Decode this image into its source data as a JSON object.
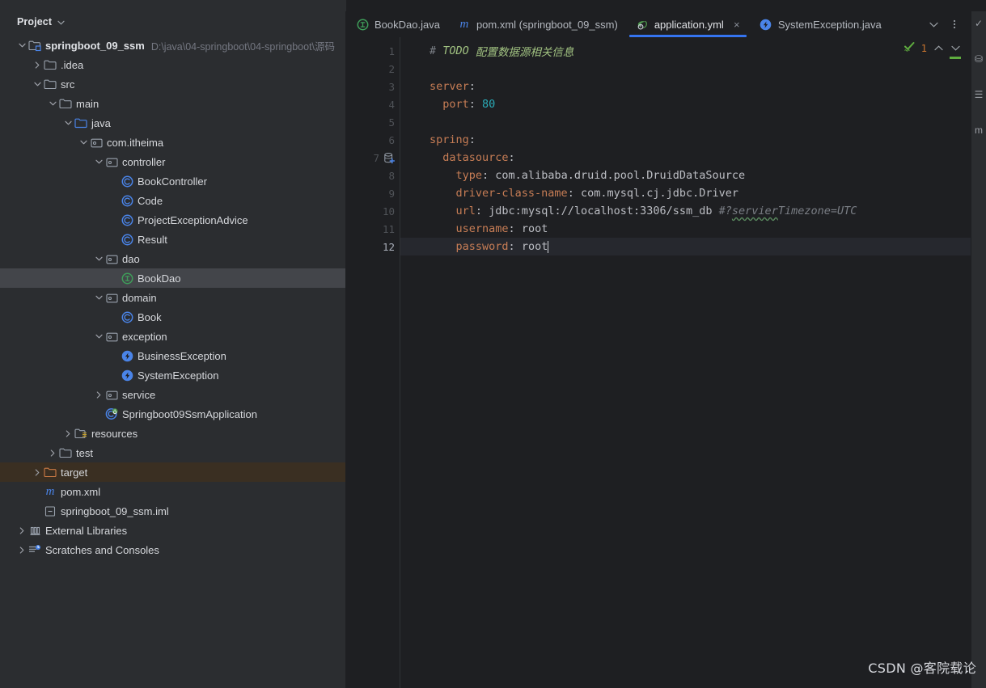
{
  "sidebar": {
    "panel_title": "Project",
    "panel_chevron": "chevron-down",
    "tree": [
      {
        "indent": 0,
        "arrow": "down",
        "icon": "module-folder-icon",
        "label": "springboot_09_ssm",
        "bold": true,
        "sub": "D:\\java\\04-springboot\\04-springboot\\源码",
        "state": "normal"
      },
      {
        "indent": 1,
        "arrow": "right",
        "icon": "folder-icon",
        "label": ".idea",
        "bold": false,
        "sub": "",
        "state": "normal"
      },
      {
        "indent": 1,
        "arrow": "down",
        "icon": "folder-icon",
        "label": "src",
        "bold": false,
        "sub": "",
        "state": "normal"
      },
      {
        "indent": 2,
        "arrow": "down",
        "icon": "folder-icon",
        "label": "main",
        "bold": false,
        "sub": "",
        "state": "normal"
      },
      {
        "indent": 3,
        "arrow": "down",
        "icon": "source-root-icon",
        "label": "java",
        "bold": false,
        "sub": "",
        "state": "normal"
      },
      {
        "indent": 4,
        "arrow": "down",
        "icon": "package-icon",
        "label": "com.itheima",
        "bold": false,
        "sub": "",
        "state": "normal"
      },
      {
        "indent": 5,
        "arrow": "down",
        "icon": "package-icon",
        "label": "controller",
        "bold": false,
        "sub": "",
        "state": "normal"
      },
      {
        "indent": 6,
        "arrow": "none",
        "icon": "class-icon",
        "label": "BookController",
        "bold": false,
        "sub": "",
        "state": "normal"
      },
      {
        "indent": 6,
        "arrow": "none",
        "icon": "class-icon",
        "label": "Code",
        "bold": false,
        "sub": "",
        "state": "normal"
      },
      {
        "indent": 6,
        "arrow": "none",
        "icon": "class-icon",
        "label": "ProjectExceptionAdvice",
        "bold": false,
        "sub": "",
        "state": "normal"
      },
      {
        "indent": 6,
        "arrow": "none",
        "icon": "class-icon",
        "label": "Result",
        "bold": false,
        "sub": "",
        "state": "normal"
      },
      {
        "indent": 5,
        "arrow": "down",
        "icon": "package-icon",
        "label": "dao",
        "bold": false,
        "sub": "",
        "state": "normal"
      },
      {
        "indent": 6,
        "arrow": "none",
        "icon": "interface-icon",
        "label": "BookDao",
        "bold": false,
        "sub": "",
        "state": "selected"
      },
      {
        "indent": 5,
        "arrow": "down",
        "icon": "package-icon",
        "label": "domain",
        "bold": false,
        "sub": "",
        "state": "normal"
      },
      {
        "indent": 6,
        "arrow": "none",
        "icon": "class-icon",
        "label": "Book",
        "bold": false,
        "sub": "",
        "state": "normal"
      },
      {
        "indent": 5,
        "arrow": "down",
        "icon": "package-icon",
        "label": "exception",
        "bold": false,
        "sub": "",
        "state": "normal"
      },
      {
        "indent": 6,
        "arrow": "none",
        "icon": "exception-class-icon",
        "label": "BusinessException",
        "bold": false,
        "sub": "",
        "state": "normal"
      },
      {
        "indent": 6,
        "arrow": "none",
        "icon": "exception-class-icon",
        "label": "SystemException",
        "bold": false,
        "sub": "",
        "state": "normal"
      },
      {
        "indent": 5,
        "arrow": "right",
        "icon": "package-icon",
        "label": "service",
        "bold": false,
        "sub": "",
        "state": "normal"
      },
      {
        "indent": 5,
        "arrow": "none",
        "icon": "spring-boot-class-icon",
        "label": "Springboot09SsmApplication",
        "bold": false,
        "sub": "",
        "state": "normal"
      },
      {
        "indent": 3,
        "arrow": "right",
        "icon": "resources-root-icon",
        "label": "resources",
        "bold": false,
        "sub": "",
        "state": "normal"
      },
      {
        "indent": 2,
        "arrow": "right",
        "icon": "folder-icon",
        "label": "test",
        "bold": false,
        "sub": "",
        "state": "normal"
      },
      {
        "indent": 1,
        "arrow": "right",
        "icon": "excluded-folder-icon",
        "label": "target",
        "bold": false,
        "sub": "",
        "state": "excluded"
      },
      {
        "indent": 1,
        "arrow": "none",
        "icon": "maven-icon",
        "label": "pom.xml",
        "bold": false,
        "sub": "",
        "state": "normal"
      },
      {
        "indent": 1,
        "arrow": "none",
        "icon": "iml-file-icon",
        "label": "springboot_09_ssm.iml",
        "bold": false,
        "sub": "",
        "state": "normal"
      },
      {
        "indent": 0,
        "arrow": "right",
        "icon": "external-libraries-icon",
        "label": "External Libraries",
        "bold": false,
        "sub": "",
        "state": "normal"
      },
      {
        "indent": 0,
        "arrow": "right",
        "icon": "scratches-icon",
        "label": "Scratches and Consoles",
        "bold": false,
        "sub": "",
        "state": "normal"
      }
    ]
  },
  "editor": {
    "tabs": [
      {
        "label": "BookDao.java",
        "icon": "interface-icon",
        "active": false,
        "closable": false
      },
      {
        "label": "pom.xml (springboot_09_ssm)",
        "icon": "maven-icon",
        "active": false,
        "closable": false
      },
      {
        "label": "application.yml",
        "icon": "spring-yaml-icon",
        "active": true,
        "closable": true
      },
      {
        "label": "SystemException.java",
        "icon": "exception-class-icon",
        "active": false,
        "closable": false
      }
    ],
    "tab_actions": [
      {
        "name": "tab-list-dropdown",
        "glyph": "chevron-down-icon"
      },
      {
        "name": "tab-more-options",
        "glyph": "more-vertical-icon"
      }
    ],
    "close_glyph": "×",
    "inspection": {
      "status_icon": "inspection-ok-icon",
      "warning_count": "1",
      "prev_glyph": "chevron-up-icon",
      "next_glyph": "chevron-down-icon"
    },
    "lines": [
      {
        "num": "1",
        "gutter_icon": "",
        "current": false,
        "tokens": [
          {
            "t": "comment",
            "v": "# "
          },
          {
            "t": "todo-kw",
            "v": "TODO"
          },
          {
            "t": "todo",
            "v": " 配置数据源相关信息"
          }
        ]
      },
      {
        "num": "2",
        "gutter_icon": "",
        "current": false,
        "tokens": []
      },
      {
        "num": "3",
        "gutter_icon": "",
        "current": false,
        "tokens": [
          {
            "t": "key",
            "v": "server"
          },
          {
            "t": "punct",
            "v": ":"
          }
        ]
      },
      {
        "num": "4",
        "gutter_icon": "",
        "current": false,
        "tokens": [
          {
            "t": "key",
            "v": "  port"
          },
          {
            "t": "punct",
            "v": ": "
          },
          {
            "t": "num",
            "v": "80"
          }
        ]
      },
      {
        "num": "5",
        "gutter_icon": "",
        "current": false,
        "tokens": []
      },
      {
        "num": "6",
        "gutter_icon": "",
        "current": false,
        "tokens": [
          {
            "t": "key",
            "v": "spring"
          },
          {
            "t": "punct",
            "v": ":"
          }
        ]
      },
      {
        "num": "7",
        "gutter_icon": "datasource-add-icon",
        "current": false,
        "tokens": [
          {
            "t": "key",
            "v": "  datasource"
          },
          {
            "t": "punct",
            "v": ":"
          }
        ]
      },
      {
        "num": "8",
        "gutter_icon": "",
        "current": false,
        "tokens": [
          {
            "t": "key",
            "v": "    type"
          },
          {
            "t": "punct",
            "v": ": "
          },
          {
            "t": "val",
            "v": "com.alibaba.druid.pool.DruidDataSource"
          }
        ]
      },
      {
        "num": "9",
        "gutter_icon": "",
        "current": false,
        "tokens": [
          {
            "t": "key",
            "v": "    driver-class-name"
          },
          {
            "t": "punct",
            "v": ": "
          },
          {
            "t": "val",
            "v": "com.mysql.cj.jdbc.Driver"
          }
        ]
      },
      {
        "num": "10",
        "gutter_icon": "",
        "current": false,
        "tokens": [
          {
            "t": "key",
            "v": "    url"
          },
          {
            "t": "punct",
            "v": ": "
          },
          {
            "t": "val",
            "v": "jdbc:mysql://localhost:3306/ssm_db "
          },
          {
            "t": "comment",
            "v": "#?"
          },
          {
            "t": "comment-squiggle",
            "v": "servier"
          },
          {
            "t": "comment",
            "v": "Timezone=UTC"
          }
        ]
      },
      {
        "num": "11",
        "gutter_icon": "",
        "current": false,
        "tokens": [
          {
            "t": "key",
            "v": "    username"
          },
          {
            "t": "punct",
            "v": ": "
          },
          {
            "t": "val",
            "v": "root"
          }
        ]
      },
      {
        "num": "12",
        "gutter_icon": "",
        "current": true,
        "tokens": [
          {
            "t": "key",
            "v": "    password"
          },
          {
            "t": "punct",
            "v": ": "
          },
          {
            "t": "val",
            "v": "root"
          },
          {
            "t": "caret",
            "v": ""
          }
        ]
      }
    ]
  },
  "rightbar": {
    "items": [
      {
        "name": "notifications-icon",
        "glyph": "✓"
      },
      {
        "name": "database-icon",
        "glyph": "⛁"
      },
      {
        "name": "bookmarks-icon",
        "glyph": "☰"
      },
      {
        "name": "maven-tool-icon",
        "glyph": "m"
      }
    ]
  },
  "watermark": {
    "text": "CSDN @客院载论"
  },
  "colors": {
    "accent_blue": "#3574f0",
    "sidebar_bg": "#2b2d30",
    "editor_bg": "#1e1f22",
    "selection_bg": "#43454a",
    "excluded_bg": "#3a2f22",
    "warning_orange": "#c9742e",
    "ok_green": "#5fad3f"
  }
}
